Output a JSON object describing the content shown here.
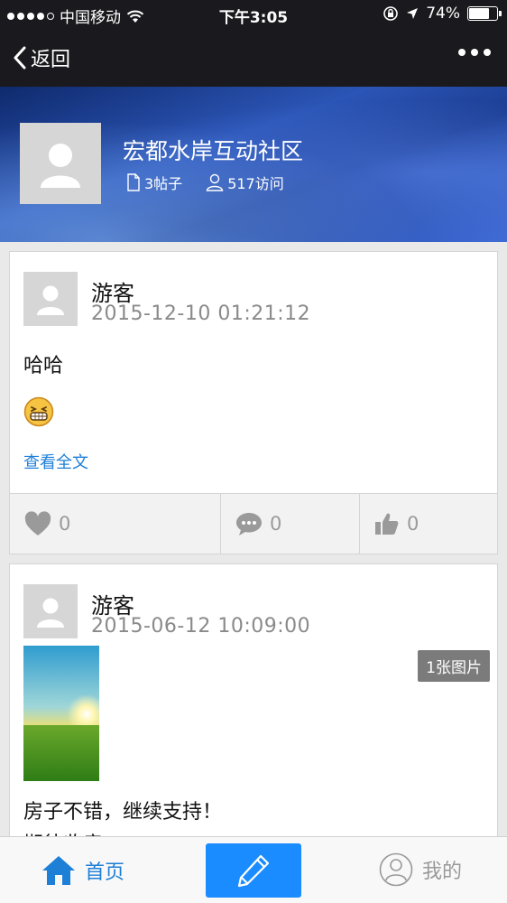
{
  "status_bar": {
    "carrier": "中国移动",
    "time": "下午3:05",
    "battery": "74%",
    "battery_level": 0.74
  },
  "nav": {
    "back_label": "返回"
  },
  "community": {
    "name": "宏都水岸互动社区",
    "posts_count": "3帖子",
    "visits_count": "517访问"
  },
  "posts": [
    {
      "author": "游客",
      "time": "2015-12-10 01:21:12",
      "text": "哈哈",
      "view_full": "查看全文",
      "likes": "0",
      "comments": "0",
      "thumbs": "0"
    },
    {
      "author": "游客",
      "time": "2015-06-12 10:09:00",
      "image_count": "1张图片",
      "text": "房子不错，继续支持！",
      "text_line2": "期待收房"
    }
  ],
  "tabbar": {
    "home_label": "首页",
    "mine_label": "我的"
  },
  "colors": {
    "accent": "#1a8cff",
    "link": "#1e7fd7",
    "dark_bar": "#1a1a1e"
  },
  "icons": {
    "back": "chevron-left-icon",
    "more": "more-icon",
    "posts": "document-icon",
    "visits": "user-outline-icon",
    "like": "heart-icon",
    "comment": "comment-icon",
    "thumb": "thumbs-up-icon",
    "home": "home-icon",
    "compose": "pencil-icon",
    "mine": "user-circle-icon"
  }
}
